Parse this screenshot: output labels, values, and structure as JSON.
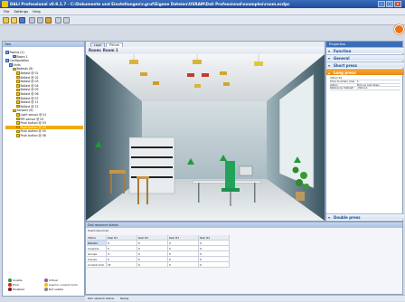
{
  "window": {
    "title": "DALI Professional v0.9.1.7 - C:\\Dokumente und Einstellungen\\r.gruf\\Eigene Dateien\\OSRAM\\Dali Professional\\examples\\room.ecdpc"
  },
  "menu": [
    "File",
    "Settings",
    "Help"
  ],
  "left_panel": {
    "title": "Tree",
    "tree": [
      {
        "label": "Rooms (1)",
        "indent": 0,
        "icon": "blue"
      },
      {
        "label": "Room 1",
        "indent": 2,
        "icon": "blue"
      },
      {
        "label": "Configuration",
        "indent": 0,
        "icon": "blue"
      },
      {
        "label": "Units",
        "indent": 1,
        "icon": "blue"
      },
      {
        "label": "Ballasts (8)",
        "indent": 2,
        "icon": "yellow"
      },
      {
        "label": "Ballast @ 01",
        "indent": 3,
        "icon": "yellow"
      },
      {
        "label": "Ballast @ 02",
        "indent": 3,
        "icon": "yellow"
      },
      {
        "label": "Ballast @ 03",
        "indent": 3,
        "icon": "yellow"
      },
      {
        "label": "Ballast @ 04",
        "indent": 3,
        "icon": "yellow"
      },
      {
        "label": "Ballast @ 05",
        "indent": 3,
        "icon": "yellow"
      },
      {
        "label": "Ballast @ 06",
        "indent": 3,
        "icon": "yellow"
      },
      {
        "label": "Ballast @ 07",
        "indent": 3,
        "icon": "yellow"
      },
      {
        "label": "Ballast @ 11",
        "indent": 3,
        "icon": "yellow"
      },
      {
        "label": "Ballast @ 12",
        "indent": 3,
        "icon": "yellow"
      },
      {
        "label": "Sensors (6)",
        "indent": 2,
        "icon": "yellow"
      },
      {
        "label": "Light sensor @ 01",
        "indent": 3,
        "icon": "yellow"
      },
      {
        "label": "PIR sensor @ 02",
        "indent": 3,
        "icon": "yellow"
      },
      {
        "label": "Push button @ 03",
        "indent": 3,
        "icon": "yellow"
      },
      {
        "label": "Push button @ 04",
        "indent": 3,
        "icon": "yellow",
        "selected": true
      },
      {
        "label": "Push button @ 05",
        "indent": 3,
        "icon": "yellow"
      },
      {
        "label": "Push button @ 06",
        "indent": 3,
        "icon": "yellow"
      }
    ],
    "legend": [
      {
        "label": "Unable",
        "color": "#2e9a2e"
      },
      {
        "label": "Virtual",
        "color": "#9a5aa8"
      },
      {
        "label": "Error",
        "color": "#d22b1f"
      },
      {
        "label": "Used in current room",
        "color": "#f2c400"
      },
      {
        "label": "Disabled",
        "color": "#7a1f1f"
      },
      {
        "label": "Not usable",
        "color": "#8a8a8a"
      }
    ]
  },
  "center": {
    "tabs": [
      "Logic",
      "Picture"
    ],
    "active_tab": "Picture",
    "room_title": "Room: Room 1"
  },
  "right_panel": {
    "title": "Properties",
    "groups": [
      {
        "label": "Function",
        "state": "closed"
      },
      {
        "label": "General",
        "state": "closed"
      },
      {
        "label": "Short press",
        "state": "closed"
      },
      {
        "label": "Long press",
        "state": "open"
      },
      {
        "label": "Double press",
        "state": "closed"
      }
    ],
    "long_press_rows": [
      {
        "k": "Action 01",
        "v": ""
      },
      {
        "k": "Time to action (ms)",
        "v": "1"
      },
      {
        "k": "Action",
        "v": "Dim up and down"
      },
      {
        "k": "Reference (ballast)",
        "v": "<None>"
      }
    ]
  },
  "bottom_panel": {
    "title": "Dali resource status",
    "subtitle": "Used resources",
    "columns": [
      "Status",
      "Real #1",
      "Real #2",
      "Real #3",
      "Real #4"
    ],
    "rows": [
      {
        "label": "Ballasts",
        "values": [
          "9",
          "0",
          "0",
          "0"
        ]
      },
      {
        "label": "Couplers",
        "values": [
          "0",
          "0",
          "0",
          "0"
        ]
      },
      {
        "label": "Groups",
        "values": [
          "4",
          "0",
          "0",
          "0"
        ]
      },
      {
        "label": "Scenes",
        "values": [
          "0",
          "0",
          "0",
          "0"
        ]
      },
      {
        "label": "Current (mA)",
        "values": [
          "32",
          "0",
          "0",
          "0"
        ]
      }
    ]
  },
  "status": {
    "left": "Dali network status",
    "right": "Ready"
  },
  "colors": {
    "accent": "#f2a900",
    "title_blue": "#1d4c9a",
    "tree_yellow": "#f2c400"
  }
}
